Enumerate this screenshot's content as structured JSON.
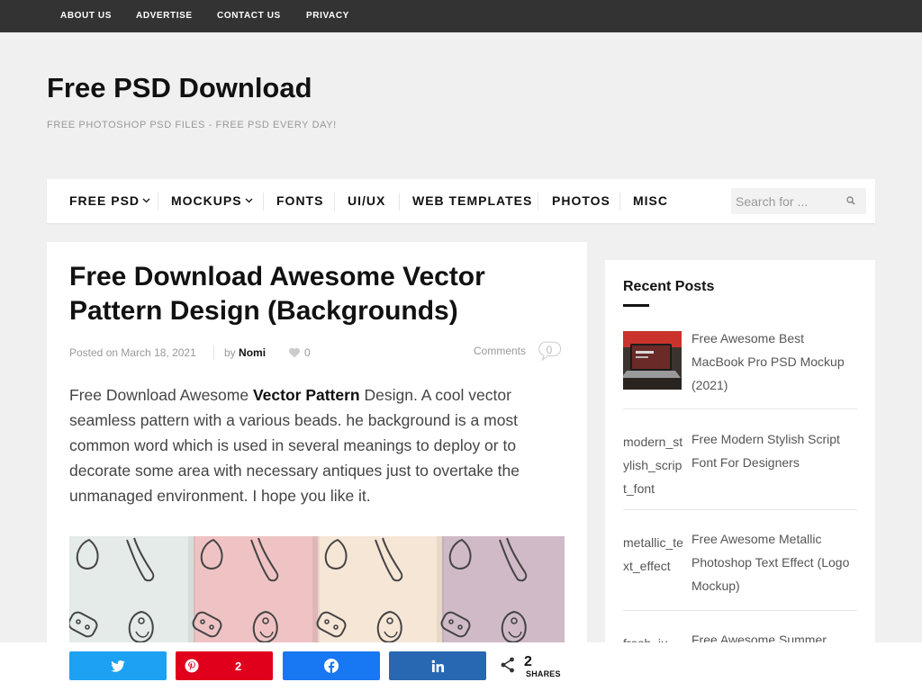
{
  "top_menu": [
    "ABOUT US",
    "ADVERTISE",
    "CONTACT US",
    "PRIVACY"
  ],
  "site": {
    "title": "Free PSD Download",
    "tagline": "FREE PHOTOSHOP PSD FILES - FREE PSD EVERY DAY!"
  },
  "nav": {
    "items": [
      {
        "label": "FREE PSD",
        "has_dropdown": true
      },
      {
        "label": "MOCKUPS",
        "has_dropdown": true
      },
      {
        "label": "FONTS",
        "has_dropdown": false
      },
      {
        "label": "UI/UX",
        "has_dropdown": false
      },
      {
        "label": "WEB TEMPLATES",
        "has_dropdown": false
      },
      {
        "label": "PHOTOS",
        "has_dropdown": false
      },
      {
        "label": "MISC",
        "has_dropdown": false
      }
    ],
    "search_placeholder": "Search for ..."
  },
  "post": {
    "title": "Free Download Awesome Vector Pattern Design (Backgrounds)",
    "meta": {
      "posted_on_label": "Posted on",
      "date": "March 18, 2021",
      "by_label": "by",
      "author": "Nomi",
      "likes": "0",
      "comments_label": "Comments",
      "comments_count": "0"
    },
    "excerpt": {
      "before": "Free Download Awesome ",
      "bold": "Vector Pattern",
      "after": " Design. A cool vector seamless pattern with a various beads. he background is a most common word which is used in several meanings to deploy or to decorate some area with necessary antiques just to overtake the unmanaged environment. I hope you like it."
    },
    "pattern_colors": [
      "#e4ebe8",
      "#efc3c4",
      "#f6e6d6",
      "#d0bac8"
    ]
  },
  "sidebar": {
    "widget_title": "Recent Posts",
    "posts": [
      {
        "title": "Free Awesome Best MacBook Pro PSD Mockup (2021)",
        "thumb_alt": "",
        "has_image": true
      },
      {
        "title": "Free Modern Stylish Script Font For Designers",
        "thumb_alt": "modern_stylish_script_font",
        "has_image": false
      },
      {
        "title": "Free Awesome Metallic Photoshop Text Effect (Logo Mockup)",
        "thumb_alt": "metallic_text_effect",
        "has_image": false
      },
      {
        "title": "Free Awesome Summer Juice",
        "thumb_alt": "fresh_ju",
        "has_image": false
      }
    ]
  },
  "share": {
    "twitter_label": "",
    "pinterest_count": "2",
    "facebook_label": "",
    "linkedin_label": "",
    "total": "2",
    "total_label": "SHARES"
  },
  "colors": {
    "topbar": "#333333",
    "twitter": "#1da1f2",
    "pinterest": "#e0001c",
    "facebook": "#1877f2",
    "linkedin": "#2867b2"
  }
}
